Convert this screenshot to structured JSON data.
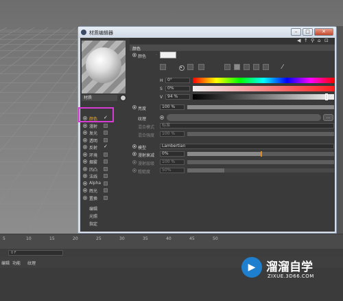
{
  "timeline": {
    "ticks": [
      "5",
      "10",
      "15",
      "20",
      "25",
      "30",
      "35",
      "40",
      "45",
      "50"
    ],
    "frame": "0 F"
  },
  "menu": {
    "items": [
      "编辑",
      "功能",
      "纹理"
    ]
  },
  "window": {
    "title": "材质编辑器"
  },
  "material": {
    "name": "材质"
  },
  "channels": [
    {
      "label": "颜色",
      "checked": true,
      "active": true
    },
    {
      "label": "漫射",
      "checked": false,
      "active": false
    },
    {
      "label": "发光",
      "checked": false,
      "active": false
    },
    {
      "label": "透明",
      "checked": false,
      "active": false
    },
    {
      "label": "反射",
      "checked": true,
      "active": false
    },
    {
      "label": "环境",
      "checked": false,
      "active": false
    },
    {
      "label": "烟雾",
      "checked": false,
      "active": false
    },
    {
      "label": "凹凸",
      "checked": false,
      "active": false
    },
    {
      "label": "法线",
      "checked": false,
      "active": false
    },
    {
      "label": "Alpha",
      "checked": false,
      "active": false
    },
    {
      "label": "辉光",
      "checked": false,
      "active": false
    },
    {
      "label": "置换",
      "checked": false,
      "active": false
    }
  ],
  "sublinks": [
    "编辑",
    "光照",
    "指定"
  ],
  "section": {
    "title": "颜色"
  },
  "color": {
    "label": "颜色",
    "h_label": "H",
    "h_value": "0°",
    "s_label": "S",
    "s_value": "0%",
    "v_label": "V",
    "v_value": "94 %",
    "swatch": "#f0f0f0"
  },
  "brightness": {
    "label": "亮度",
    "value": "100 %",
    "percent": 100
  },
  "texture": {
    "label": "纹理",
    "button": "..."
  },
  "mix_mode": {
    "label": "混合模式",
    "value": "标准"
  },
  "mix_strength": {
    "label": "混合强度",
    "value": "100 %",
    "percent": 100
  },
  "model": {
    "label": "模型",
    "value": "Lambertian"
  },
  "diffuse_falloff": {
    "label": "漫射衰减",
    "value": "0%",
    "percent": 50
  },
  "diffuse_level": {
    "label": "漫射层级",
    "value": "100 %",
    "percent": 100
  },
  "roughness": {
    "label": "粗糙度",
    "value": "50%",
    "percent": 25
  },
  "watermark": {
    "brand": "溜溜自学",
    "url": "ZIXUE.3D66.COM"
  },
  "colors": {
    "active_label": "#f2a623",
    "highlight": "#d63bd6",
    "accent_marker": "#e08a1e"
  }
}
